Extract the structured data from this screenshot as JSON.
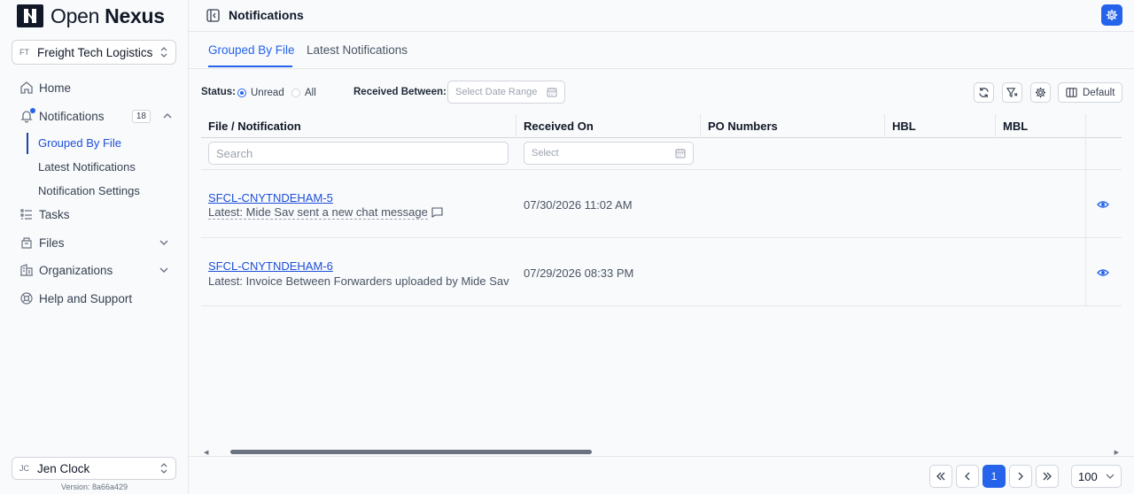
{
  "app": {
    "logo_text_light": "Open",
    "logo_text_bold": "Nexus",
    "version": "Version: 8a66a429"
  },
  "org": {
    "initials": "FT",
    "name": "Freight Tech Logistics"
  },
  "sidebar": {
    "items": [
      {
        "label": "Home"
      },
      {
        "label": "Notifications",
        "badge": "18"
      },
      {
        "label": "Tasks"
      },
      {
        "label": "Files"
      },
      {
        "label": "Organizations"
      },
      {
        "label": "Help and Support"
      }
    ],
    "subitems": [
      {
        "label": "Grouped By File"
      },
      {
        "label": "Latest Notifications"
      },
      {
        "label": "Notification Settings"
      }
    ]
  },
  "user": {
    "initials": "JC",
    "name": "Jen Clock"
  },
  "header": {
    "title": "Notifications"
  },
  "tabs": [
    {
      "label": "Grouped By File",
      "active": true
    },
    {
      "label": "Latest Notifications",
      "active": false
    }
  ],
  "filters": {
    "status_label": "Status:",
    "unread_label": "Unread",
    "all_label": "All",
    "selected_status": "Unread",
    "received_between_label": "Received Between:",
    "date_range_placeholder": "Select Date Range",
    "default_label": "Default"
  },
  "table": {
    "headers": [
      "File / Notification",
      "Received On",
      "PO Numbers",
      "HBL",
      "MBL"
    ],
    "search_placeholder": "Search",
    "date_placeholder": "Select",
    "rows": [
      {
        "file": "SFCL-CNYTNDEHAM-5",
        "latest": "Latest: Mide Sav sent a new chat message",
        "received": "07/30/2026 11:02 AM"
      },
      {
        "file": "SFCL-CNYTNDEHAM-6",
        "latest": "Latest: Invoice Between Forwarders uploaded by Mide Sav",
        "received": "07/29/2026 08:33 PM"
      }
    ]
  },
  "pagination": {
    "current_page": "1",
    "page_size": "100"
  },
  "colors": {
    "accent": "#2563eb",
    "link": "#1d4ed8"
  }
}
